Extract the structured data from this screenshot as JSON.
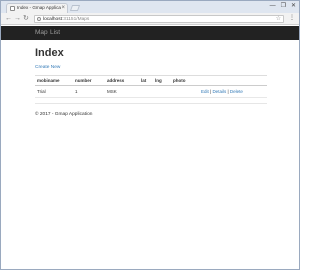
{
  "browser": {
    "tab_title": "Index - Gmap Application",
    "tab_close": "×",
    "url_host": "localhost",
    "url_path": ":31151/Maps",
    "window_controls": [
      "—",
      "❐",
      "✕"
    ]
  },
  "navbar": {
    "brand": "Map",
    "links": [
      "List"
    ]
  },
  "main": {
    "title": "Index",
    "create_link": "Create New",
    "table": {
      "headers": [
        "mobiname",
        "number",
        "address",
        "lat",
        "lng",
        "photo"
      ],
      "rows": [
        {
          "mobiname": "Trial",
          "number": "1",
          "address": "MSK",
          "lat": "",
          "lng": "",
          "photo": "",
          "actions": [
            "Edit",
            "Details",
            "Delete"
          ]
        }
      ]
    }
  },
  "footer": {
    "text": "© 2017 - Gmap Application"
  }
}
